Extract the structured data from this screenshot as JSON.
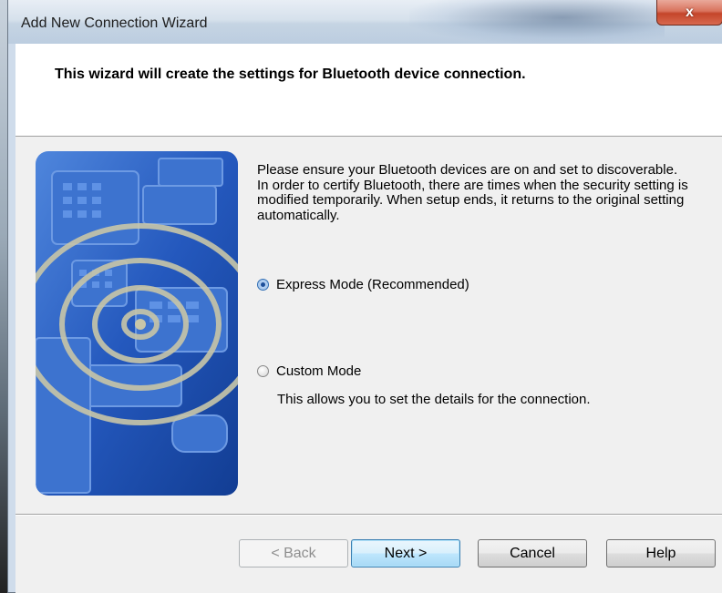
{
  "window": {
    "title": "Add New Connection Wizard",
    "close_glyph": "x"
  },
  "header": {
    "text": "This wizard will create the settings for Bluetooth device connection."
  },
  "body": {
    "paragraph_1": "Please ensure your Bluetooth devices are on and set to discoverable.",
    "paragraph_2": "In order to certify Bluetooth, there are times when the security setting is modified temporarily. When setup ends, it returns to the original setting automatically."
  },
  "options": {
    "express": {
      "label": "Express Mode (Recommended)",
      "selected": true
    },
    "custom": {
      "label": "Custom Mode",
      "selected": false,
      "description": "This allows you to set the details for the connection."
    }
  },
  "buttons": {
    "back": "< Back",
    "next": "Next >",
    "cancel": "Cancel",
    "help": "Help"
  },
  "colors": {
    "side_image_base": "#1f56b8",
    "accent_blue": "#2f6db3"
  }
}
